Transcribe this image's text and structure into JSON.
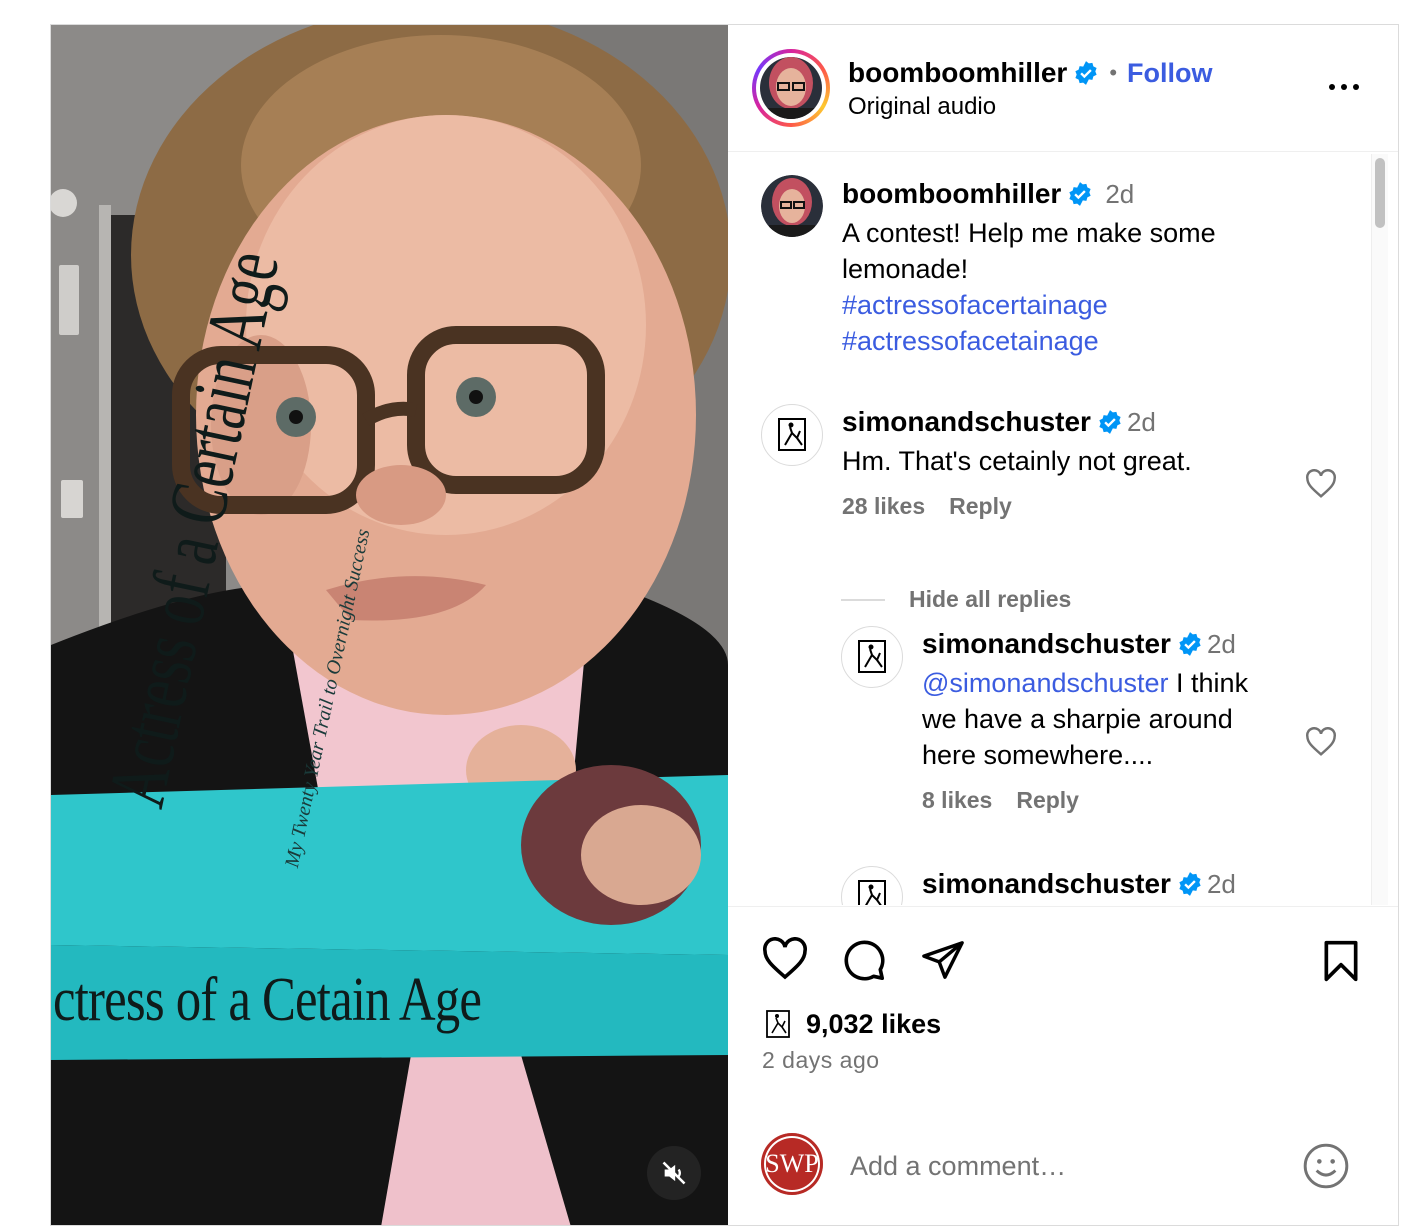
{
  "post": {
    "username": "boomboomhiller",
    "follow_label": "Follow",
    "separator": "•",
    "audio": "Original audio",
    "more_icon": "more-horizontal-icon"
  },
  "media": {
    "book_cover_title": "Actress of a Certain Age",
    "book_spine_text": "ctress of a Cetain Age",
    "book_subtitle": "My Twenty Year Trail to Overnight Success",
    "mute_icon": "speaker-muted-icon"
  },
  "caption": {
    "username": "boomboomhiller",
    "time": "2d",
    "text_line1": "A contest! Help me make some",
    "text_line2": "lemonade!",
    "hashtag1": "#actressofacertainage",
    "hashtag2": "#actressofacetainage"
  },
  "comments": [
    {
      "username": "simonandschuster",
      "time": "2d",
      "text": "Hm. That's cetainly not great.",
      "likes": "28 likes",
      "reply": "Reply"
    }
  ],
  "replies_toggle": "Hide all replies",
  "replies": [
    {
      "username": "simonandschuster",
      "time": "2d",
      "mention": "@simonandschuster",
      "text_line1": " I think",
      "text_line2": "we have a sharpie around",
      "text_line3": "here somewhere....",
      "likes": "8 likes",
      "reply": "Reply"
    },
    {
      "username": "simonandschuster",
      "time": "2d"
    }
  ],
  "footer": {
    "likes": "9,032 likes",
    "timestamp": "2 days ago",
    "comment_placeholder": "Add a comment…",
    "commenter_avatar_text": "SWP"
  },
  "colors": {
    "link_blue": "#3b5ce0",
    "verified_blue": "#0095f6",
    "muted_text": "#737373",
    "book_teal": "#2ec4c9"
  }
}
